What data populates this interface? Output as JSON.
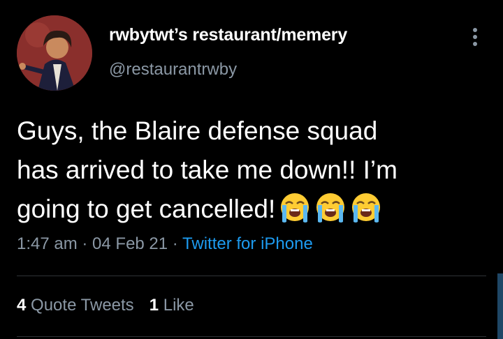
{
  "user": {
    "display_name": "rwbytwt’s restaurant/memery",
    "handle": "@restaurantrwby"
  },
  "tweet": {
    "text": "Guys, the Blaire defense squad\nhas arrived to take me down!! I’m\ngoing to get cancelled!",
    "emoji": [
      "loudly-crying-face",
      "loudly-crying-face",
      "loudly-crying-face"
    ]
  },
  "meta": {
    "time": "1:47 am",
    "sep1": " · ",
    "date": "04 Feb 21",
    "sep2": " · ",
    "source": "Twitter for iPhone"
  },
  "stats": {
    "quote_count": "4",
    "quote_label": "Quote Tweets",
    "like_count": "1",
    "like_label": "Like"
  },
  "colors": {
    "background": "#000000",
    "secondary_text": "#8b98a5",
    "link": "#1d9bf0",
    "divider": "#2f3336"
  }
}
